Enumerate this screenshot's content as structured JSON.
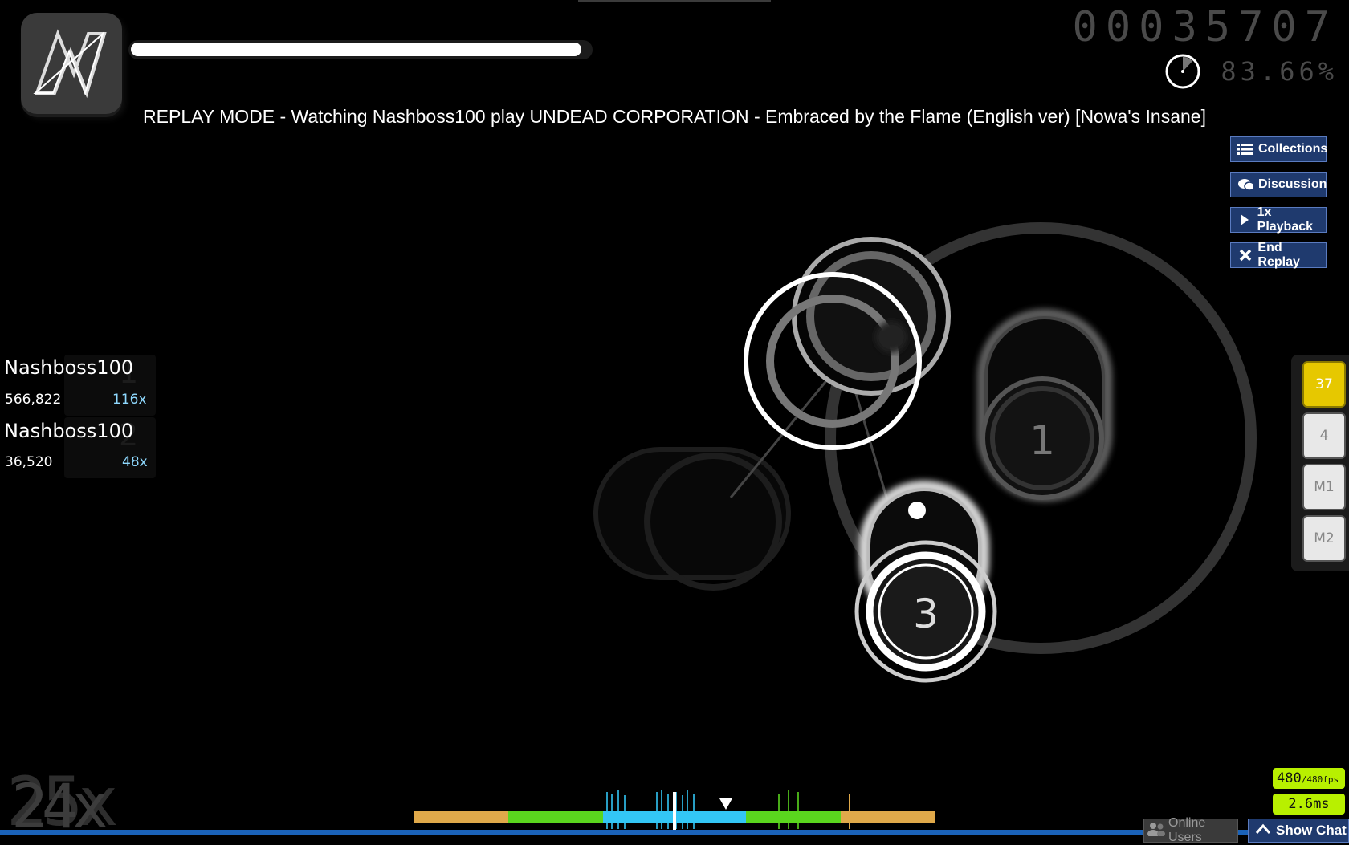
{
  "score": "00035707",
  "accuracy": "83.66%",
  "accuracy_progress": 0.8366,
  "health_fraction": 0.98,
  "replay_title": "REPLAY MODE - Watching Nashboss100 play UNDEAD CORPORATION - Embraced by the Flame (English ver) [Nowa's Insane]",
  "buttons": {
    "collections": "Collections",
    "discussion": "Discussion",
    "playback": "1x Playback",
    "end_replay": "End Replay"
  },
  "leaderboard": [
    {
      "name": "Nashboss100",
      "score": "566,822",
      "combo": "116x",
      "rank": "1"
    },
    {
      "name": "Nashboss100",
      "score": "36,520",
      "combo": "48x",
      "rank": "2"
    }
  ],
  "keys": [
    {
      "label": "37",
      "active": true
    },
    {
      "label": "4",
      "active": false
    },
    {
      "label": "M1",
      "active": false
    },
    {
      "label": "M2",
      "active": false
    }
  ],
  "hit_circles": [
    {
      "number": "1"
    },
    {
      "number": "3"
    }
  ],
  "combo": "24x",
  "combo_ghost": "25x",
  "fps_value": "480",
  "fps_max": "/480fps",
  "frame_time": "2.6ms",
  "bottom": {
    "online_users": "Online Users",
    "show_chat": "Show Chat"
  },
  "colors": {
    "button_bg": "#1f3a6e",
    "key_active": "#e6c800",
    "fps_bg": "#b8f000",
    "hit_300": "#33c6f5",
    "hit_100": "#5ad61e",
    "hit_50": "#e0a94a"
  }
}
